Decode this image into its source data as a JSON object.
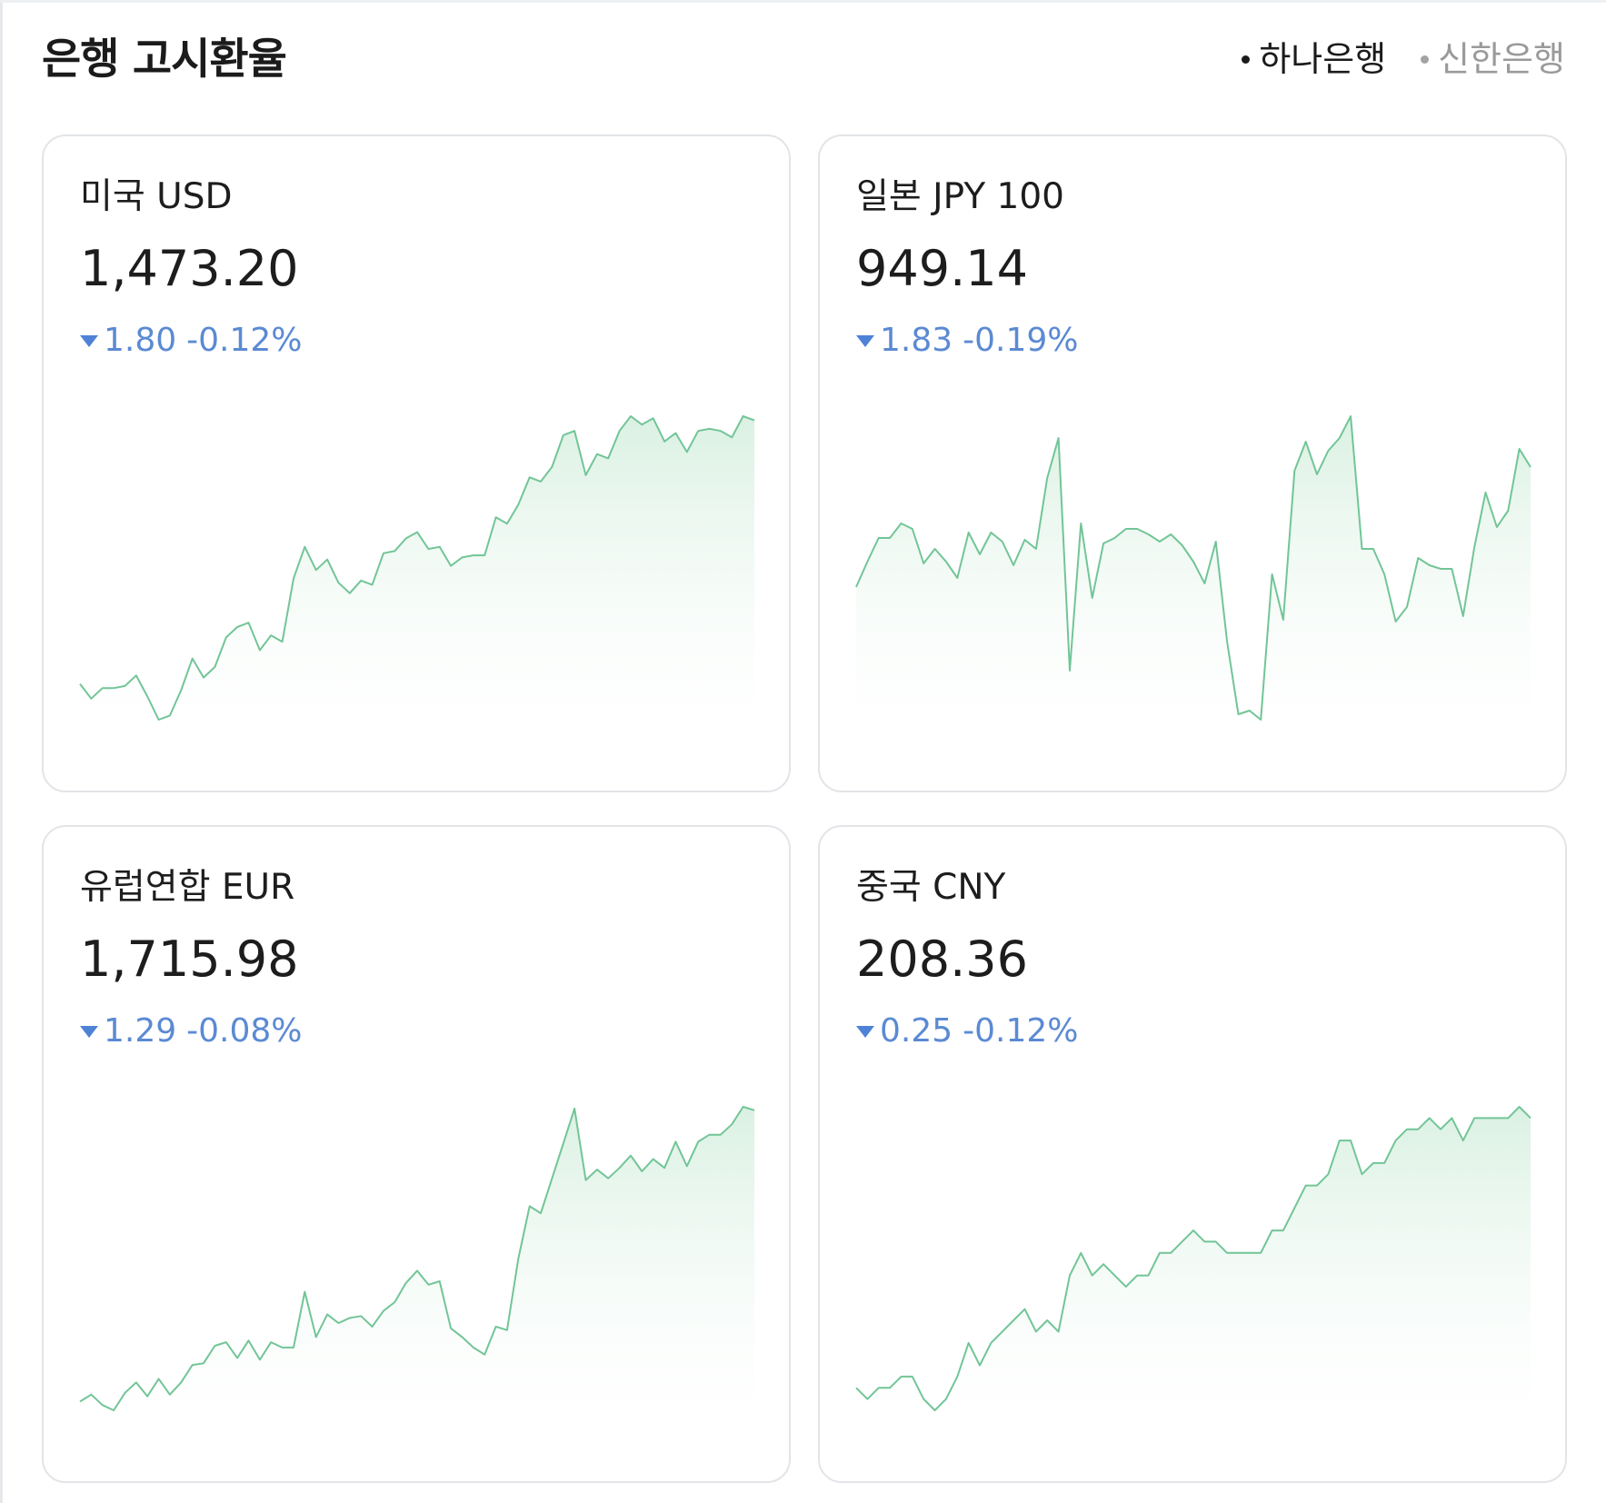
{
  "header": {
    "title": "은행 고시환율",
    "banks": [
      {
        "label": "하나은행",
        "active": true
      },
      {
        "label": "신한은행",
        "active": false
      }
    ]
  },
  "colors": {
    "line": "#72c597",
    "fill_top": "#d6efdf",
    "down": "#5b8ad3",
    "card_border": "#e2e4e7"
  },
  "cards": [
    {
      "name": "미국 USD",
      "rate": "1,473.20",
      "change": "1.80",
      "change_pct": "-0.12%",
      "direction": "down",
      "series": [
        1471.5,
        1470.8,
        1471.3,
        1471.3,
        1471.4,
        1471.9,
        1470.9,
        1469.8,
        1470.0,
        1471.2,
        1472.7,
        1471.8,
        1472.3,
        1473.7,
        1474.2,
        1474.4,
        1473.1,
        1473.8,
        1473.5,
        1476.5,
        1478.0,
        1476.9,
        1477.4,
        1476.3,
        1475.8,
        1476.4,
        1476.2,
        1477.7,
        1477.8,
        1478.4,
        1478.7,
        1477.9,
        1478.0,
        1477.1,
        1477.5,
        1477.6,
        1477.6,
        1479.4,
        1479.1,
        1480.0,
        1481.3,
        1481.1,
        1481.8,
        1483.3,
        1483.5,
        1481.4,
        1482.4,
        1482.2,
        1483.5,
        1484.2,
        1483.8,
        1484.1,
        1483.0,
        1483.4,
        1482.5,
        1483.5,
        1483.6,
        1483.5,
        1483.2,
        1484.2,
        1484.0
      ]
    },
    {
      "name": "일본 JPY 100",
      "rate": "949.14",
      "change": "1.83",
      "change_pct": "-0.19%",
      "direction": "down",
      "series": [
        949.4,
        950.8,
        952.1,
        952.1,
        952.9,
        952.6,
        950.7,
        951.5,
        950.8,
        949.9,
        952.4,
        951.2,
        952.4,
        951.9,
        950.6,
        952.0,
        951.5,
        955.4,
        957.6,
        944.8,
        952.9,
        948.8,
        951.8,
        952.1,
        952.6,
        952.6,
        952.3,
        951.9,
        952.3,
        951.7,
        950.8,
        949.6,
        951.9,
        946.4,
        942.4,
        942.6,
        942.1,
        950.1,
        947.6,
        955.8,
        957.4,
        955.6,
        956.9,
        957.6,
        958.8,
        951.5,
        951.5,
        950.1,
        947.5,
        948.3,
        951.0,
        950.6,
        950.4,
        950.4,
        947.8,
        951.6,
        954.6,
        952.7,
        953.6,
        957.0,
        956.0
      ]
    },
    {
      "name": "유럽연합 EUR",
      "rate": "1,715.98",
      "change": "1.29",
      "change_pct": "-0.08%",
      "direction": "down",
      "series": [
        1711.9,
        1712.3,
        1711.7,
        1711.4,
        1712.4,
        1713.0,
        1712.2,
        1713.2,
        1712.3,
        1713.0,
        1714.0,
        1714.1,
        1715.1,
        1715.3,
        1714.4,
        1715.4,
        1714.3,
        1715.3,
        1715.0,
        1715.0,
        1718.2,
        1715.6,
        1716.9,
        1716.4,
        1716.7,
        1716.8,
        1716.2,
        1717.1,
        1717.6,
        1718.7,
        1719.4,
        1718.6,
        1718.8,
        1716.1,
        1715.6,
        1715.0,
        1714.6,
        1716.2,
        1716.0,
        1720.1,
        1723.1,
        1722.7,
        1724.7,
        1726.7,
        1728.7,
        1724.6,
        1725.2,
        1724.7,
        1725.3,
        1726.0,
        1725.1,
        1725.8,
        1725.3,
        1726.8,
        1725.4,
        1726.8,
        1727.2,
        1727.2,
        1727.8,
        1728.8,
        1728.6
      ]
    },
    {
      "name": "중국 CNY",
      "rate": "208.36",
      "change": "0.25",
      "change_pct": "-0.12%",
      "direction": "down",
      "series": [
        206.6,
        206.5,
        206.6,
        206.6,
        206.7,
        206.7,
        206.5,
        206.4,
        206.5,
        206.7,
        207.0,
        206.8,
        207.0,
        207.1,
        207.2,
        207.3,
        207.1,
        207.2,
        207.1,
        207.6,
        207.8,
        207.6,
        207.7,
        207.6,
        207.5,
        207.6,
        207.6,
        207.8,
        207.8,
        207.9,
        208.0,
        207.9,
        207.9,
        207.8,
        207.8,
        207.8,
        207.8,
        208.0,
        208.0,
        208.2,
        208.4,
        208.4,
        208.5,
        208.8,
        208.8,
        208.5,
        208.6,
        208.6,
        208.8,
        208.9,
        208.9,
        209.0,
        208.9,
        209.0,
        208.8,
        209.0,
        209.0,
        209.0,
        209.0,
        209.1,
        209.0
      ]
    }
  ]
}
